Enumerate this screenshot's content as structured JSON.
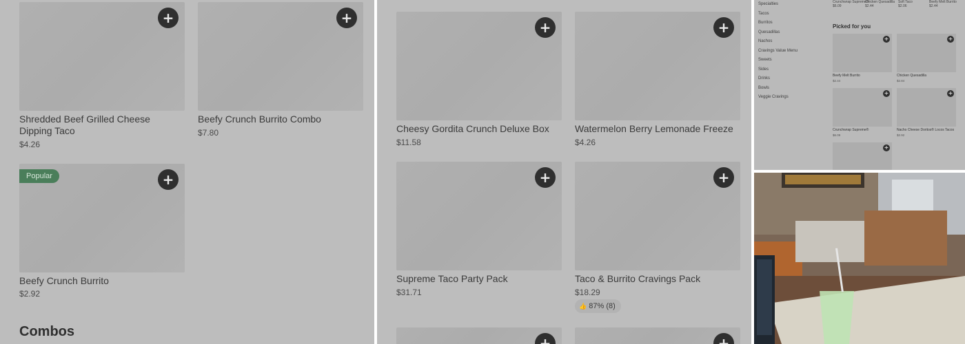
{
  "left_panel": {
    "items": [
      {
        "name": "Shredded Beef Grilled Cheese Dipping Taco",
        "price": "$4.26"
      },
      {
        "name": "Beefy Crunch Burrito Combo",
        "price": "$7.80"
      },
      {
        "name": "Beefy Crunch Burrito",
        "price": "$2.92",
        "badge": "Popular"
      }
    ],
    "section_title": "Combos"
  },
  "middle_panel": {
    "items": [
      {
        "name": "Cheesy Gordita Crunch Deluxe Box",
        "price": "$11.58"
      },
      {
        "name": "Watermelon Berry Lemonade Freeze",
        "price": "$4.26"
      },
      {
        "name": "Supreme Taco Party Pack",
        "price": "$31.71"
      },
      {
        "name": "Taco & Burrito Cravings Pack",
        "price": "$18.29",
        "rating": "87% (8)"
      }
    ]
  },
  "right_panel": {
    "nav": [
      "Specialties",
      "Tacos",
      "Burritos",
      "Quesadillas",
      "Nachos",
      "Cravings Value Menu",
      "Sweets",
      "Sides",
      "Drinks",
      "Bowls",
      "Veggie Cravings"
    ],
    "top_row": [
      {
        "name": "Crunchwrap Supreme®",
        "price": "$6.09"
      },
      {
        "name": "Chicken Quesadilla",
        "price": "$2.44"
      },
      {
        "name": "Soft Taco",
        "price": "$2.06"
      },
      {
        "name": "Beefy Melt Burrito",
        "price": "$2.44"
      }
    ],
    "section_title": "Picked for you",
    "picked": [
      {
        "name": "Beefy Melt Burrito",
        "price": "$2.44"
      },
      {
        "name": "Chicken Quesadilla",
        "price": "$2.84"
      },
      {
        "name": "Crunchwrap Supreme®",
        "price": "$6.09"
      },
      {
        "name": "Nacho Cheese Doritos® Locos Tacos",
        "price": "$2.92"
      },
      {
        "name": "",
        "price": ""
      }
    ]
  },
  "icons": {
    "plus": "+",
    "thumbs_up": "👍"
  }
}
